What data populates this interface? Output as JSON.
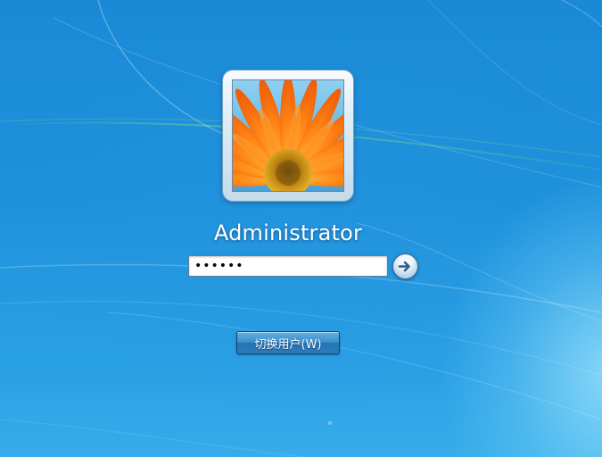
{
  "login": {
    "user_name": "Administrator",
    "password_value": "••••••",
    "switch_user_label": "切换用户(W)"
  },
  "icons": {
    "submit": "arrow-right-icon",
    "avatar": "flower-avatar"
  },
  "colors": {
    "background": "#1f92dc",
    "button": "#2b7bbb",
    "text": "#ffffff",
    "avatar_petals": "#ff7a10",
    "avatar_center": "#d9a31a"
  }
}
